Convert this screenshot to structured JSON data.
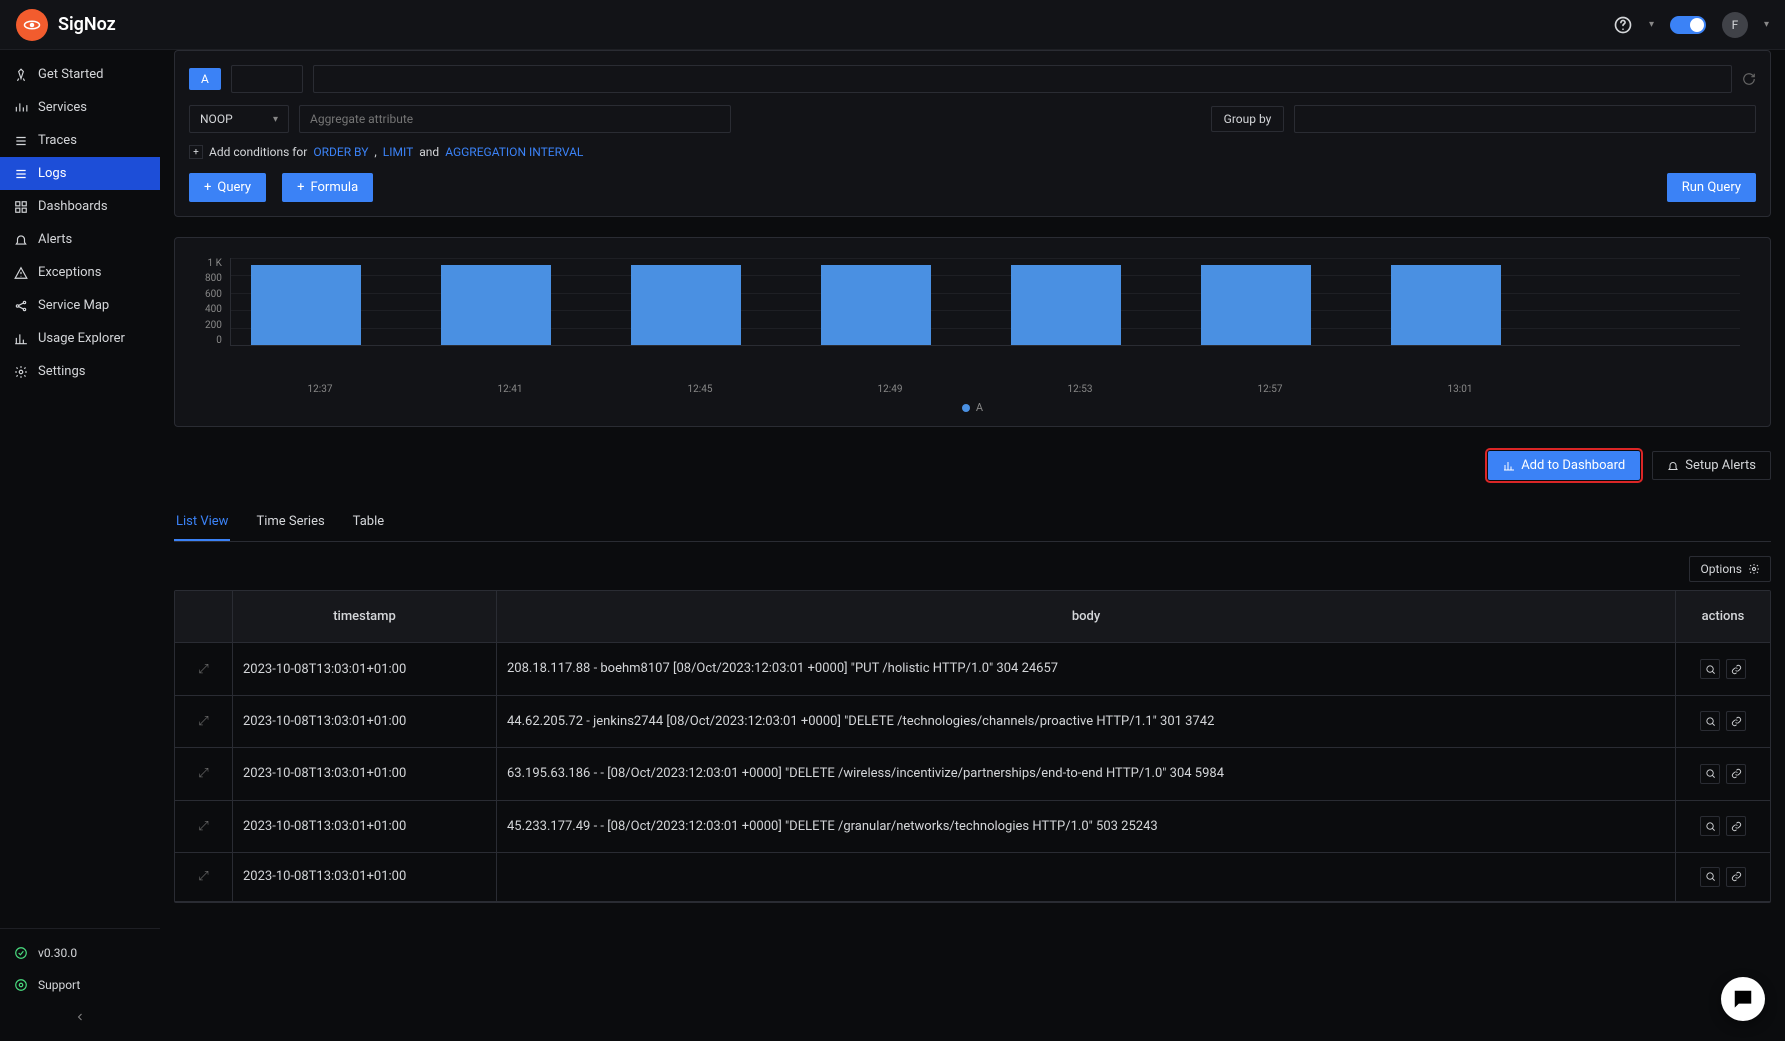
{
  "brand": "SigNoz",
  "avatar_initial": "F",
  "sidebar": {
    "items": [
      {
        "label": "Get Started",
        "icon": "rocket"
      },
      {
        "label": "Services",
        "icon": "bars"
      },
      {
        "label": "Traces",
        "icon": "menu"
      },
      {
        "label": "Logs",
        "icon": "list",
        "active": true
      },
      {
        "label": "Dashboards",
        "icon": "grid"
      },
      {
        "label": "Alerts",
        "icon": "bell"
      },
      {
        "label": "Exceptions",
        "icon": "warn"
      },
      {
        "label": "Service Map",
        "icon": "share"
      },
      {
        "label": "Usage Explorer",
        "icon": "chart"
      },
      {
        "label": "Settings",
        "icon": "gear"
      }
    ],
    "version": "v0.30.0",
    "support": "Support"
  },
  "query": {
    "noop": "NOOP",
    "aggregate_placeholder": "Aggregate attribute",
    "groupby": "Group by",
    "cond_prefix": "Add conditions for ",
    "order_by": "ORDER BY",
    "sep1": ", ",
    "limit": "LIMIT",
    "sep2": " and ",
    "agg_interval": "AGGREGATION INTERVAL",
    "query_btn": "Query",
    "formula_btn": "Formula",
    "run": "Run Query"
  },
  "chart_data": {
    "type": "bar",
    "categories": [
      "12:37",
      "12:41",
      "12:45",
      "12:49",
      "12:53",
      "12:57",
      "13:01"
    ],
    "values": [
      1000,
      1000,
      1000,
      1000,
      1000,
      1000,
      1000
    ],
    "yticks": [
      "1 K",
      "800",
      "600",
      "400",
      "200",
      "0"
    ],
    "ylim": [
      0,
      1000
    ],
    "series_name": "A"
  },
  "actions": {
    "add_dash": "Add to Dashboard",
    "setup_alerts": "Setup Alerts"
  },
  "tabs": [
    "List View",
    "Time Series",
    "Table"
  ],
  "options_label": "Options",
  "table": {
    "headers": {
      "timestamp": "timestamp",
      "body": "body",
      "actions": "actions"
    },
    "rows": [
      {
        "ts": "2023-10-08T13:03:01+01:00",
        "body": "208.18.117.88 - boehm8107 [08/Oct/2023:12:03:01 +0000] \"PUT /holistic HTTP/1.0\" 304 24657"
      },
      {
        "ts": "2023-10-08T13:03:01+01:00",
        "body": "44.62.205.72 - jenkins2744 [08/Oct/2023:12:03:01 +0000] \"DELETE /technologies/channels/proactive HTTP/1.1\" 301 3742"
      },
      {
        "ts": "2023-10-08T13:03:01+01:00",
        "body": "63.195.63.186 - - [08/Oct/2023:12:03:01 +0000] \"DELETE /wireless/incentivize/partnerships/end-to-end HTTP/1.0\" 304 5984"
      },
      {
        "ts": "2023-10-08T13:03:01+01:00",
        "body": "45.233.177.49 - - [08/Oct/2023:12:03:01 +0000] \"DELETE /granular/networks/technologies HTTP/1.0\" 503 25243"
      },
      {
        "ts": "2023-10-08T13:03:01+01:00",
        "body": ""
      }
    ]
  }
}
